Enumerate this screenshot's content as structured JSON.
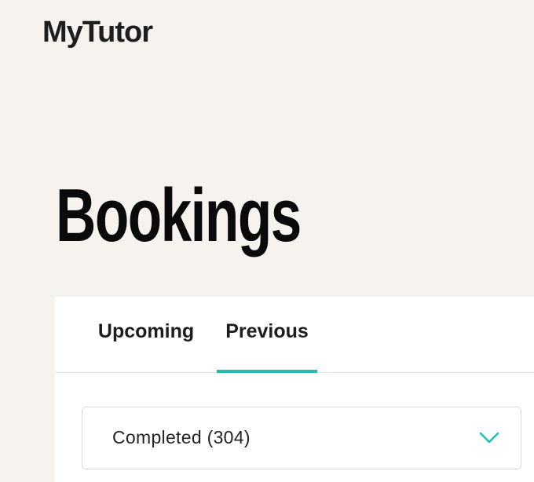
{
  "header": {
    "logo_text": "MyTutor"
  },
  "page": {
    "title": "Bookings"
  },
  "tabs": [
    {
      "label": "Upcoming",
      "active": false
    },
    {
      "label": "Previous",
      "active": true
    }
  ],
  "filter": {
    "selected_label": "Completed (304)",
    "icon": "chevron-down-icon"
  },
  "colors": {
    "page_background": "#f6f2ee",
    "accent": "#1fbfb0",
    "card_background": "#ffffff",
    "text_primary": "#1d1d1d"
  }
}
